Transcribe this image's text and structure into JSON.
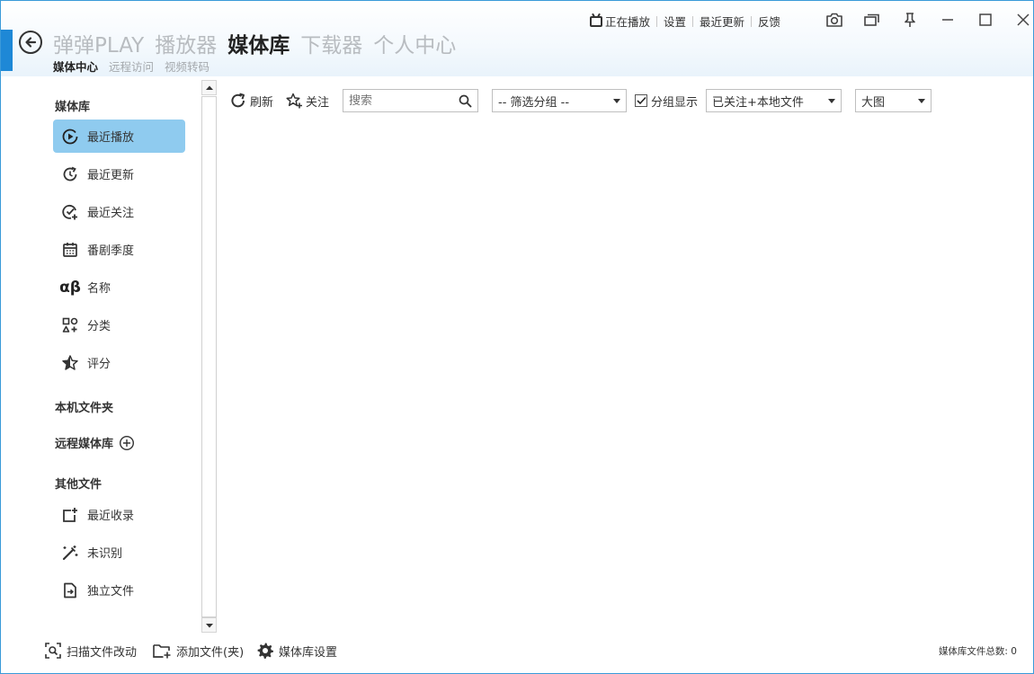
{
  "header": {
    "nav_tabs": [
      {
        "label": "弹弹PLAY",
        "active": false
      },
      {
        "label": "播放器",
        "active": false
      },
      {
        "label": "媒体库",
        "active": true
      },
      {
        "label": "下载器",
        "active": false
      },
      {
        "label": "个人中心",
        "active": false
      }
    ],
    "sub_tabs": [
      {
        "label": "媒体中心",
        "active": true
      },
      {
        "label": "远程访问",
        "active": false
      },
      {
        "label": "视频转码",
        "active": false
      }
    ],
    "top_links": {
      "now_playing": "正在播放",
      "settings": "设置",
      "recent_updates": "最近更新",
      "feedback": "反馈"
    },
    "window_controls": [
      "camera-icon",
      "pip-icon",
      "pin-icon",
      "minimize-icon",
      "maximize-icon",
      "close-icon"
    ]
  },
  "sidebar": {
    "library_title": "媒体库",
    "items": [
      {
        "label": "最近播放",
        "icon": "play-circle-icon",
        "active": true
      },
      {
        "label": "最近更新",
        "icon": "refresh-clock-icon",
        "active": false
      },
      {
        "label": "最近关注",
        "icon": "check-add-icon",
        "active": false
      },
      {
        "label": "番剧季度",
        "icon": "calendar-icon",
        "active": false
      },
      {
        "label": "名称",
        "icon": "alpha-beta-icon",
        "active": false
      },
      {
        "label": "分类",
        "icon": "shapes-icon",
        "active": false
      },
      {
        "label": "评分",
        "icon": "star-half-icon",
        "active": false
      }
    ],
    "local_folders_title": "本机文件夹",
    "remote_library_title": "远程媒体库",
    "other_files_title": "其他文件",
    "other_items": [
      {
        "label": "最近收录",
        "icon": "add-frame-icon"
      },
      {
        "label": "未识别",
        "icon": "magic-wand-icon"
      },
      {
        "label": "独立文件",
        "icon": "file-arrow-icon"
      }
    ]
  },
  "toolbar": {
    "refresh_label": "刷新",
    "follow_label": "关注",
    "search_placeholder": "搜索",
    "group_filter_value": "-- 筛选分组 --",
    "group_display_label": "分组显示",
    "group_display_checked": true,
    "source_value": "已关注+本地文件",
    "view_value": "大图"
  },
  "footer": {
    "scan_label": "扫描文件改动",
    "add_label": "添加文件(夹)",
    "settings_label": "媒体库设置",
    "status_text": "媒体库文件总数: 0"
  },
  "colors": {
    "accent": "#1e88d6",
    "active_item": "#8fcbef",
    "inactive_tab": "#b8bcc0"
  }
}
